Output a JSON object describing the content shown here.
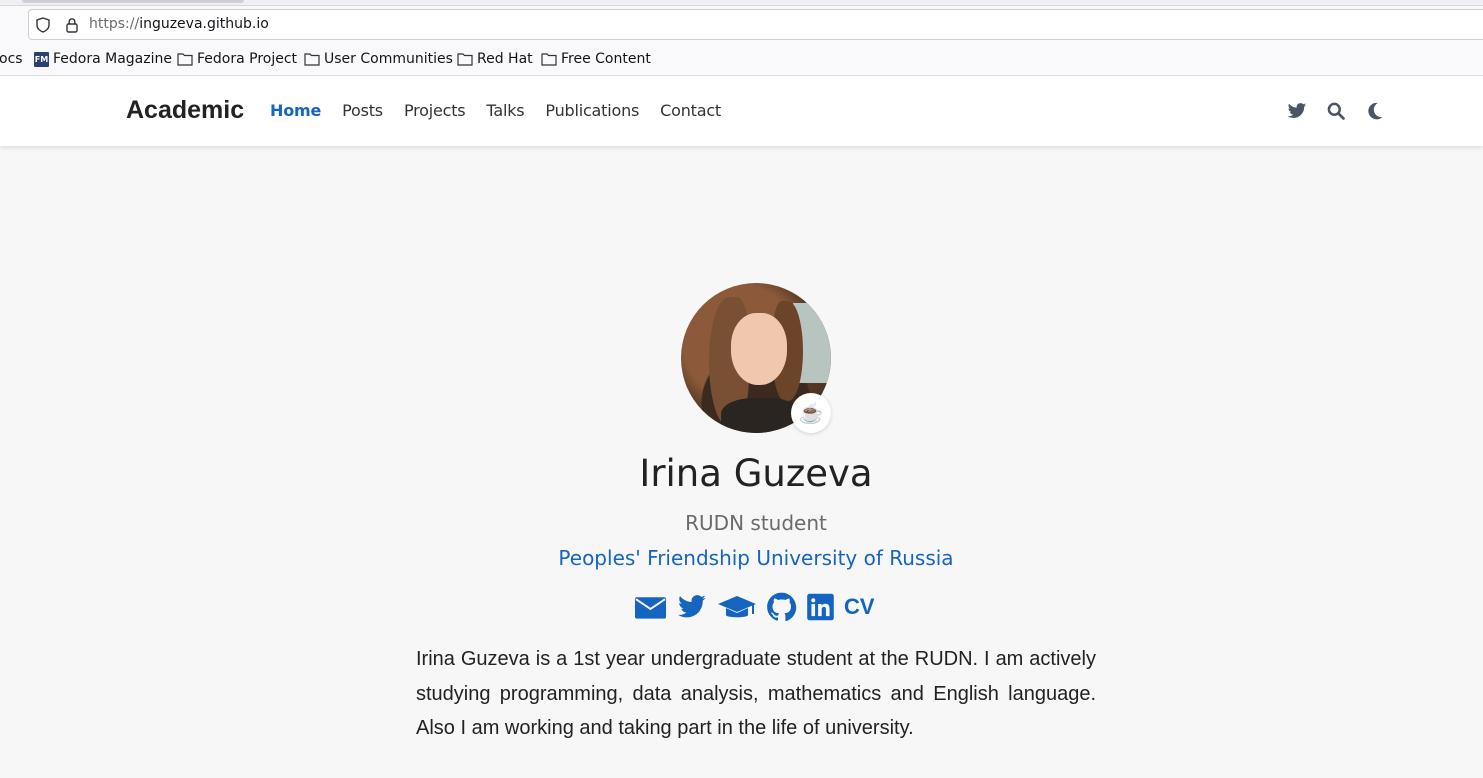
{
  "browser": {
    "url_scheme": "https://",
    "url_host": "inguzeva.github.io",
    "bookmarks": [
      {
        "label": "ocs",
        "icon": "folder-icon"
      },
      {
        "label": "Fedora Magazine",
        "icon": "fedora-magazine-icon"
      },
      {
        "label": "Fedora Project",
        "icon": "folder-icon"
      },
      {
        "label": "User Communities",
        "icon": "folder-icon"
      },
      {
        "label": "Red Hat",
        "icon": "folder-icon"
      },
      {
        "label": "Free Content",
        "icon": "folder-icon"
      }
    ]
  },
  "site": {
    "brand": "Academic",
    "nav": [
      {
        "label": "Home",
        "active": true
      },
      {
        "label": "Posts",
        "active": false
      },
      {
        "label": "Projects",
        "active": false
      },
      {
        "label": "Talks",
        "active": false
      },
      {
        "label": "Publications",
        "active": false
      },
      {
        "label": "Contact",
        "active": false
      }
    ],
    "tools": [
      "twitter-icon",
      "search-icon",
      "moon-icon"
    ],
    "accent": "#1565c0"
  },
  "profile": {
    "status_emoji": "☕",
    "name": "Irina Guzeva",
    "role": "RUDN student",
    "organization": "Peoples' Friendship University of Russia",
    "socials": [
      "envelope-icon",
      "twitter-icon",
      "graduation-cap-icon",
      "github-icon",
      "linkedin-icon"
    ],
    "cv_label": "CV",
    "bio": "Irina Guzeva is a 1st year undergraduate student at the RUDN. I am actively studying programming, data analysis, mathematics and English language. Also I am working and taking part in the life of university."
  }
}
